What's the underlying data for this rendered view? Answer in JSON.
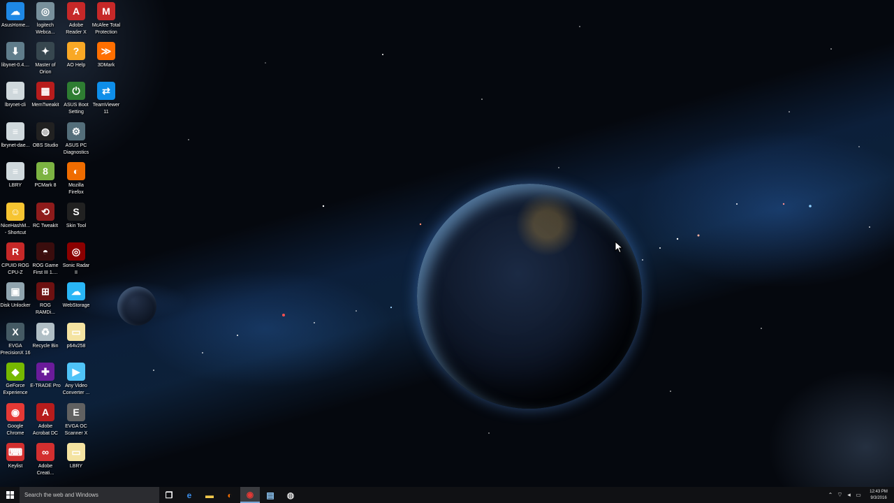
{
  "desktop_icons": [
    {
      "label": "AsusHome...",
      "icon": "asus-home-icon",
      "color": "#1e88e5",
      "glyph": "☁"
    },
    {
      "label": "libynet-0.4....",
      "icon": "installer-icon",
      "color": "#607d8b",
      "glyph": "⬇"
    },
    {
      "label": "lbrynet-cli",
      "icon": "app-stack-icon",
      "color": "#cfd8dc",
      "glyph": "≡"
    },
    {
      "label": "lbrynet-dae...",
      "icon": "app-stack-icon",
      "color": "#cfd8dc",
      "glyph": "≡"
    },
    {
      "label": "LBRY",
      "icon": "app-stack-icon",
      "color": "#cfd8dc",
      "glyph": "≡"
    },
    {
      "label": "NiceHashM...\n- Shortcut",
      "icon": "smiley-icon",
      "color": "#f6c431",
      "glyph": "☺"
    },
    {
      "label": "CPUID ROG\nCPU-Z",
      "icon": "rog-icon",
      "color": "#c62828",
      "glyph": "R"
    },
    {
      "label": "Disk Unlocker",
      "icon": "disk-icon",
      "color": "#90a4ae",
      "glyph": "▣"
    },
    {
      "label": "EVGA\nPrecisionX 16",
      "icon": "evga-icon",
      "color": "#455a64",
      "glyph": "X"
    },
    {
      "label": "GeForce\nExperience",
      "icon": "nvidia-icon",
      "color": "#76b900",
      "glyph": "◆"
    },
    {
      "label": "Google\nChrome",
      "icon": "chrome-icon",
      "color": "#e53935",
      "glyph": "◉"
    },
    {
      "label": "Keylist",
      "icon": "keylist-icon",
      "color": "#d32f2f",
      "glyph": "⌨"
    },
    {
      "label": "logitech\nWebca...",
      "icon": "webcam-icon",
      "color": "#78909c",
      "glyph": "◎"
    },
    {
      "label": "Master of\nOrion",
      "icon": "game-icon",
      "color": "#37474f",
      "glyph": "✦"
    },
    {
      "label": "MemTweakit",
      "icon": "memtweak-icon",
      "color": "#b71c1c",
      "glyph": "▦"
    },
    {
      "label": "OBS Studio",
      "icon": "obs-icon",
      "color": "#212121",
      "glyph": "◍"
    },
    {
      "label": "PCMark 8",
      "icon": "pcmark-icon",
      "color": "#7cb342",
      "glyph": "8"
    },
    {
      "label": "RC TweakIt",
      "icon": "rc-tweakit-icon",
      "color": "#8e1b1b",
      "glyph": "⟲"
    },
    {
      "label": "ROG Game\nFirst III 1....",
      "icon": "rog-gamefirst-icon",
      "color": "#3a0d0d",
      "glyph": "◓"
    },
    {
      "label": "ROG\nRAMDi...",
      "icon": "rog-ramdisk-icon",
      "color": "#6d1111",
      "glyph": "⊞"
    },
    {
      "label": "Recycle Bin",
      "icon": "recycle-bin-icon",
      "color": "#b0bec5",
      "glyph": "♻"
    },
    {
      "label": "E-TRADE Pro",
      "icon": "etrade-icon",
      "color": "#6a1b9a",
      "glyph": "✚"
    },
    {
      "label": "Adobe\nAcrobat DC",
      "icon": "acrobat-icon",
      "color": "#b71c1c",
      "glyph": "A"
    },
    {
      "label": "Adobe\nCreati...",
      "icon": "creative-cloud-icon",
      "color": "#d32f2f",
      "glyph": "∞"
    },
    {
      "label": "Adobe\nReader X",
      "icon": "adobe-reader-icon",
      "color": "#c62828",
      "glyph": "A"
    },
    {
      "label": "AO Help",
      "icon": "ao-help-icon",
      "color": "#f9a825",
      "glyph": "?"
    },
    {
      "label": "ASUS Boot\nSetting",
      "icon": "asus-boot-icon",
      "color": "#2e7d32",
      "glyph": "⏻"
    },
    {
      "label": "ASUS PC\nDiagnostics",
      "icon": "asus-diagnostics-icon",
      "color": "#546e7a",
      "glyph": "⚙"
    },
    {
      "label": "Mozilla\nFirefox",
      "icon": "firefox-icon",
      "color": "#ef6c00",
      "glyph": "◐"
    },
    {
      "label": "Skin Tool",
      "icon": "skin-tool-icon",
      "color": "#212121",
      "glyph": "S"
    },
    {
      "label": "Sonic Radar\nII",
      "icon": "sonic-radar-icon",
      "color": "#8b0000",
      "glyph": "◎"
    },
    {
      "label": "WebStorage",
      "icon": "webstorage-icon",
      "color": "#29b6f6",
      "glyph": "☁"
    },
    {
      "label": "p64v258",
      "icon": "folder-icon",
      "color": "#f4e3a1",
      "glyph": "▭"
    },
    {
      "label": "Any Video\nConverter ...",
      "icon": "video-converter-icon",
      "color": "#4fc3f7",
      "glyph": "▶"
    },
    {
      "label": "EVGA OC\nScanner X",
      "icon": "evga-oc-icon",
      "color": "#616161",
      "glyph": "E"
    },
    {
      "label": "LBRY",
      "icon": "document-icon",
      "color": "#f4e3a1",
      "glyph": "▭"
    },
    {
      "label": "McAfee Total\nProtection",
      "icon": "mcafee-icon",
      "color": "#c62828",
      "glyph": "M"
    },
    {
      "label": "3DMark",
      "icon": "3dmark-icon",
      "color": "#ff6f00",
      "glyph": "≫"
    },
    {
      "label": "TeamViewer\n11",
      "icon": "teamviewer-icon",
      "color": "#0e8ee9",
      "glyph": "⇄"
    }
  ],
  "taskbar": {
    "search_placeholder": "Search the web and Windows",
    "apps": [
      {
        "icon": "task-view-icon",
        "glyph": "❐",
        "color": "#ffffff",
        "active": false
      },
      {
        "icon": "edge-icon",
        "glyph": "e",
        "color": "#3b8eea",
        "active": false
      },
      {
        "icon": "file-explorer-icon",
        "glyph": "▬",
        "color": "#f2c94c",
        "active": false
      },
      {
        "icon": "firefox-icon",
        "glyph": "◐",
        "color": "#ef6c00",
        "active": false
      },
      {
        "icon": "chrome-icon",
        "glyph": "◉",
        "color": "#e53935",
        "active": true
      },
      {
        "icon": "notepad-icon",
        "glyph": "▤",
        "color": "#90caf9",
        "active": false
      },
      {
        "icon": "obs-icon",
        "glyph": "◍",
        "color": "#dddddd",
        "active": false
      }
    ],
    "clock_time": "12:43 PM",
    "clock_date": "9/3/2016"
  }
}
